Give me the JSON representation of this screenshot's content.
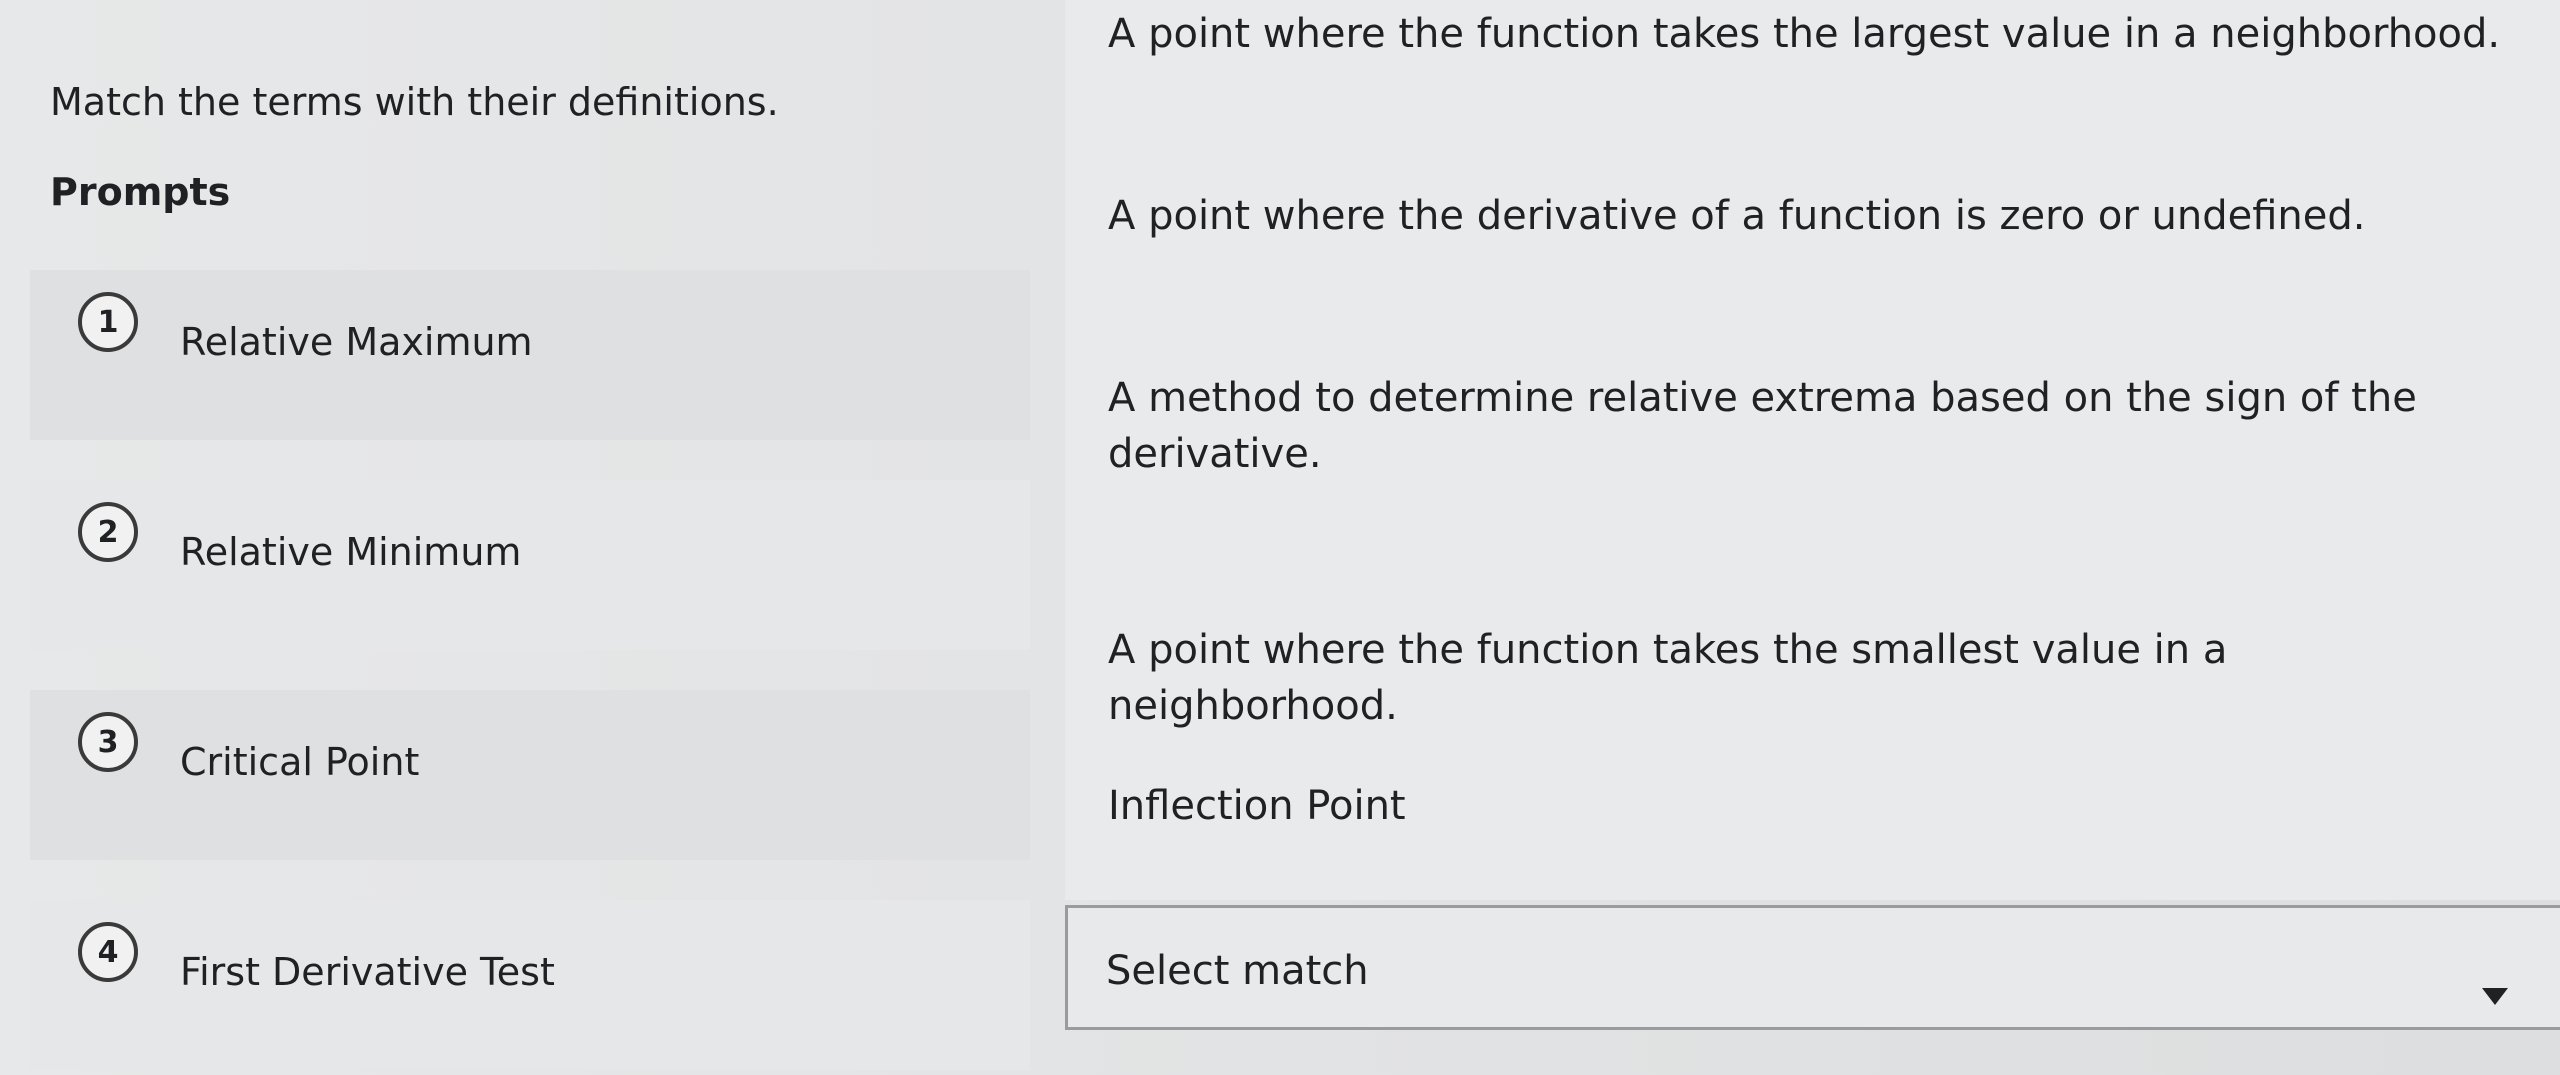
{
  "instructions": "Match the terms with their definitions.",
  "prompts_heading": "Prompts",
  "prompts": [
    {
      "number": "1",
      "label": "Relative Maximum"
    },
    {
      "number": "2",
      "label": "Relative Minimum"
    },
    {
      "number": "3",
      "label": "Critical Point"
    },
    {
      "number": "4",
      "label": "First Derivative Test"
    }
  ],
  "answers": [
    "A point where the function takes the largest value in a neighborhood.",
    "A point where the derivative of a function is zero or undefined.",
    "A method to determine relative extrema based on the sign of the derivative.",
    "A point where the function takes the smallest value in a neighborhood.",
    "Inflection Point"
  ],
  "select": {
    "placeholder": "Select match",
    "icon": "caret-down-icon"
  }
}
